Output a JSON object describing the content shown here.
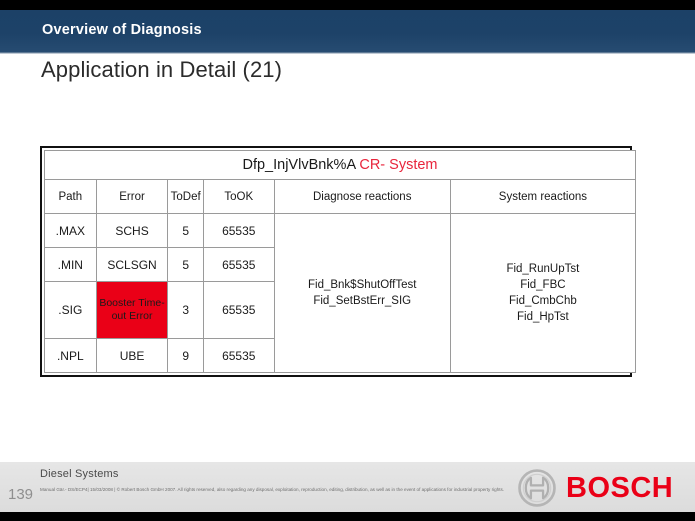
{
  "slide": {
    "band_title": "Overview of Diagnosis",
    "headline": "Application in Detail (21)"
  },
  "table": {
    "title_black": "Dfp_InjVlvBnk%A",
    "title_red": "CR- System",
    "columns": [
      "Path",
      "Error",
      "ToDef",
      "ToOK",
      "Diagnose reactions",
      "System reactions"
    ],
    "rows": [
      {
        "path": ".MAX",
        "error": "SCHS",
        "todef": "5",
        "took": "65535"
      },
      {
        "path": ".MIN",
        "error": "SCLSGN",
        "todef": "5",
        "took": "65535"
      },
      {
        "path": ".SIG",
        "error": "Booster Time-out Error",
        "todef": "3",
        "took": "65535"
      },
      {
        "path": ".NPL",
        "error": "UBE",
        "todef": "9",
        "took": "65535"
      }
    ],
    "error_highlight_row": 2,
    "error_highlight_color": "#ea0017",
    "diagnose_reactions": "Fid_Bnk$ShutOffTest\nFid_SetBstErr_SIG",
    "system_reactions": "Fid_RunUpTst\nFid_FBC\nFid_CmbChb\nFid_HpTst"
  },
  "footer": {
    "slide_number": "139",
    "department": "Diesel Systems",
    "legal": "Manual Gär.- DS/ECP4| 15/03/2008 | © Robert Bosch GmbH 2007. All rights reserved, also regarding any disposal, exploitation, reproduction, editing, distribution, as well as in the event of applications for industrial property rights.",
    "brand": "BOSCH"
  },
  "colors": {
    "band_navy": "#1d4266",
    "brand_red": "#ea0017",
    "accent_red_text": "#e8253c"
  }
}
